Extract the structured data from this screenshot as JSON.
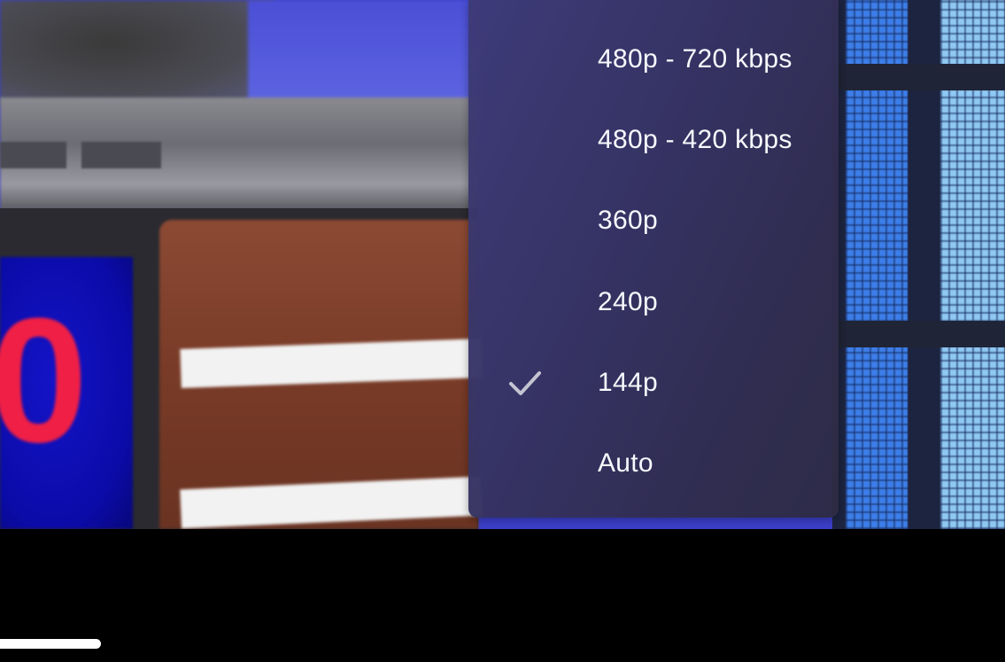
{
  "quality_menu": {
    "items": [
      {
        "label": "480p - 720 kbps",
        "selected": false
      },
      {
        "label": "480p - 420 kbps",
        "selected": false
      },
      {
        "label": "360p",
        "selected": false
      },
      {
        "label": "240p",
        "selected": false
      },
      {
        "label": "144p",
        "selected": true
      },
      {
        "label": "Auto",
        "selected": false
      }
    ],
    "check_icon": "checkmark-icon",
    "text_color": "#ffffff",
    "background_color": "#35325f"
  },
  "video": {
    "score_digit": "0"
  },
  "player": {
    "progress": 0.1
  }
}
